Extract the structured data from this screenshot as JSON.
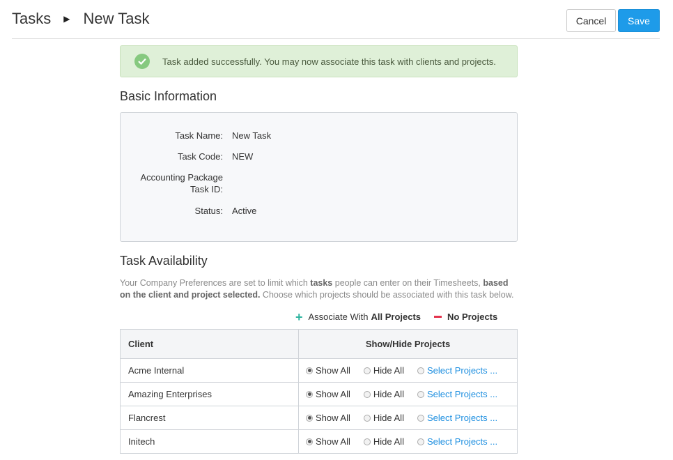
{
  "header": {
    "breadcrumb_root": "Tasks",
    "breadcrumb_sep_icon": "triangle-right-icon",
    "breadcrumb_current": "New Task",
    "cancel_label": "Cancel",
    "save_label": "Save"
  },
  "alert": {
    "icon": "check-circle-icon",
    "message": "Task added successfully. You may now associate this task with clients and projects."
  },
  "basic_info": {
    "title": "Basic Information",
    "fields": [
      {
        "label": "Task Name:",
        "value": "New Task"
      },
      {
        "label": "Task Code:",
        "value": "NEW"
      },
      {
        "label_line1": "Accounting Package",
        "label_line2": "Task ID:",
        "value": ""
      },
      {
        "label": "Status:",
        "value": "Active"
      }
    ]
  },
  "availability": {
    "title": "Task Availability",
    "desc_part1": "Your Company Preferences are set to limit which ",
    "desc_bold1": "tasks",
    "desc_part2": " people can enter on their Timesheets, ",
    "desc_bold2": "based on the client and project selected.",
    "desc_part3": "  Choose which projects should be associated with this task below.",
    "associate_prefix": "Associate With ",
    "associate_bold": "All Projects",
    "no_projects_label": "No Projects",
    "colors": {
      "plus": "#2fb4a0",
      "minus": "#e4334d",
      "link": "#1e8fe0"
    }
  },
  "table": {
    "col_client": "Client",
    "col_show_hide": "Show/Hide Projects",
    "option_show_all": "Show All",
    "option_hide_all": "Hide All",
    "option_select": "Select Projects ...",
    "rows": [
      {
        "client": "Acme Internal",
        "selected": "show_all"
      },
      {
        "client": "Amazing Enterprises",
        "selected": "show_all"
      },
      {
        "client": "Flancrest",
        "selected": "show_all"
      },
      {
        "client": "Initech",
        "selected": "show_all"
      }
    ]
  },
  "colors": {
    "save_button": "#1e9be9",
    "alert_bg": "#dff0d8"
  }
}
